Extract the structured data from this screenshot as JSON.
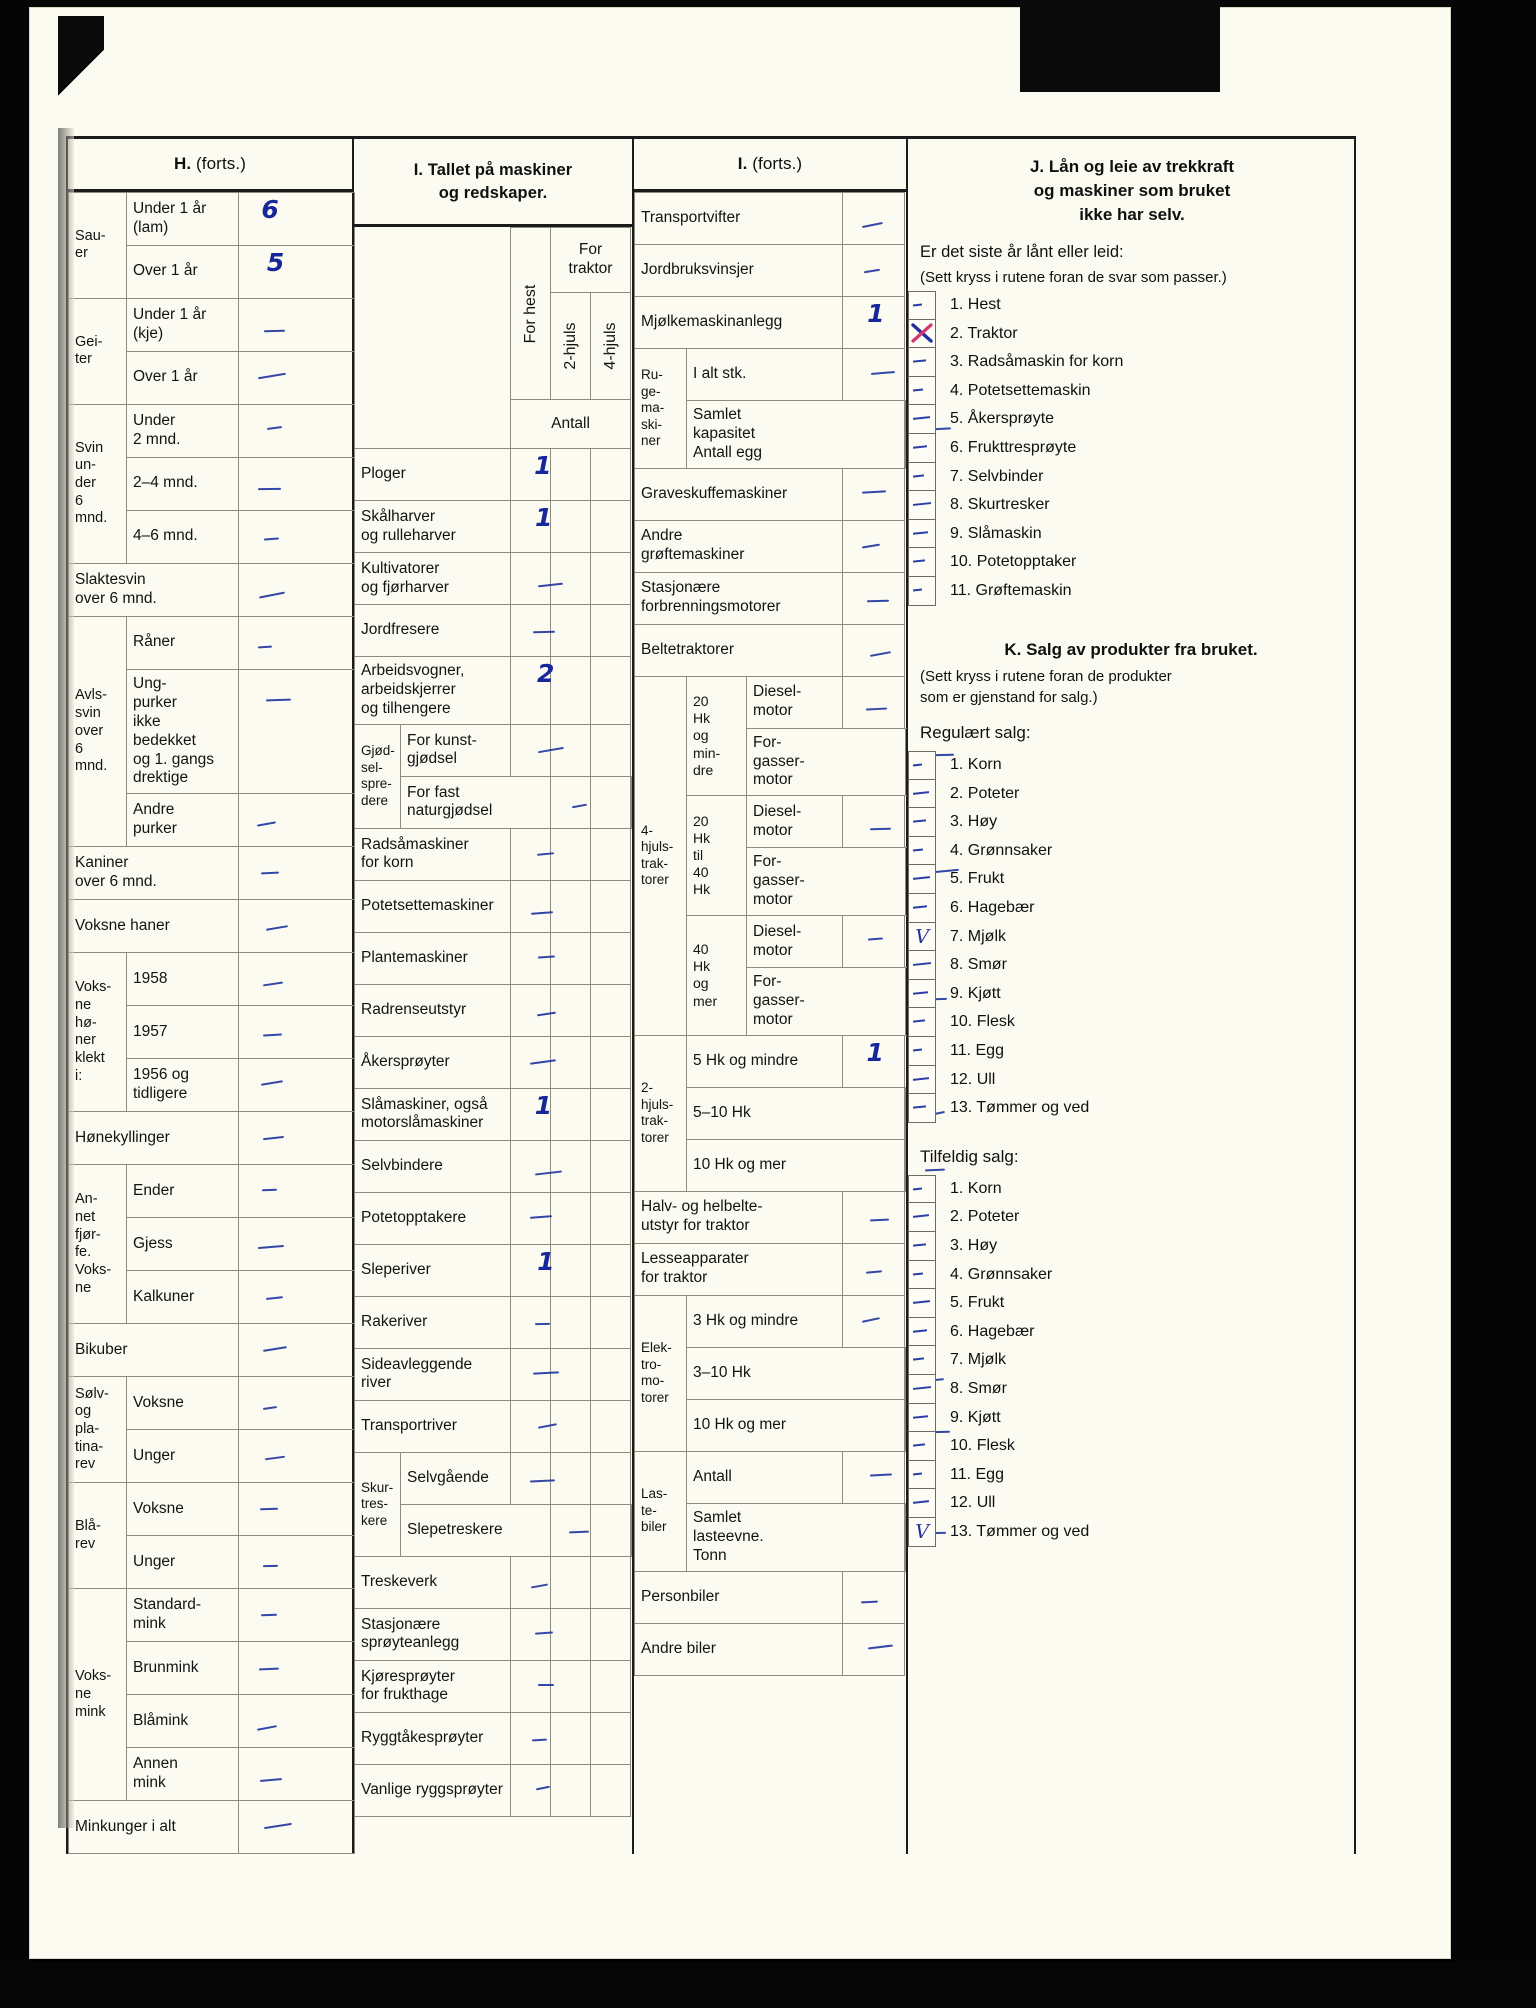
{
  "document": {
    "kind": "norwegian-agricultural-census-form",
    "ink_color": "#1f2f9c",
    "mark_color_x": "#d4356a"
  },
  "columns": {
    "H": {
      "heading_bold": "H.",
      "heading_rest": "(forts.)",
      "rows": [
        {
          "group": "Sau-\ner",
          "group_rows": 2,
          "label": "Under 1 år\n(lam)",
          "value": "6"
        },
        {
          "label": "Over 1 år",
          "value": "5"
        },
        {
          "group": "Gei-\nter",
          "group_rows": 2,
          "label": "Under 1 år\n(kje)",
          "value": "-"
        },
        {
          "label": "Over 1 år",
          "value": "-"
        },
        {
          "group": "Svin\nun-\nder\n6\nmnd.",
          "group_rows": 3,
          "label": "Under\n2 mnd.",
          "value": "-"
        },
        {
          "label": "2–4 mnd.",
          "value": "-"
        },
        {
          "label": "4–6 mnd.",
          "value": "-"
        },
        {
          "label": "Slaktesvin\nover 6 mnd.",
          "full": true,
          "value": "-"
        },
        {
          "group": "Avls-\nsvin\nover\n6\nmnd.",
          "group_rows": 3,
          "label": "Råner",
          "value": "-"
        },
        {
          "label": "Ung-\npurker\nikke\nbedekket\nog 1. gangs\ndrektige",
          "value": "-"
        },
        {
          "label": "Andre\npurker",
          "value": "-"
        },
        {
          "label": "Kaniner\nover 6 mnd.",
          "full": true,
          "value": "-"
        },
        {
          "label": "Voksne haner",
          "full": true,
          "value": "-"
        },
        {
          "group": "Voks-\nne\nhø-\nner\nklekt\ni:",
          "group_rows": 3,
          "label": "1958",
          "value": "-"
        },
        {
          "label": "1957",
          "value": "-"
        },
        {
          "label": "1956 og\ntidligere",
          "value": "-"
        },
        {
          "label": "Hønekyllinger",
          "full": true,
          "value": "-"
        },
        {
          "group": "An-\nnet\nfjør-\nfe.\nVoks-\nne",
          "group_rows": 3,
          "label": "Ender",
          "value": "-"
        },
        {
          "label": "Gjess",
          "value": "-"
        },
        {
          "label": "Kalkuner",
          "value": "-"
        },
        {
          "label": "Bikuber",
          "full": true,
          "value": "-"
        },
        {
          "group": "Sølv-\nog\npla-\ntina-\nrev",
          "group_rows": 2,
          "label": "Voksne",
          "value": "-"
        },
        {
          "label": "Unger",
          "value": "-"
        },
        {
          "group": "Blå-\nrev",
          "group_rows": 2,
          "label": "Voksne",
          "value": "-"
        },
        {
          "label": "Unger",
          "value": "-"
        },
        {
          "group": "Voks-\nne\nmink",
          "group_rows": 4,
          "label": "Standard-\nmink",
          "value": "-"
        },
        {
          "label": "Brunmink",
          "value": "-"
        },
        {
          "label": "Blåmink",
          "value": "-"
        },
        {
          "label": "Annen\nmink",
          "value": "-"
        },
        {
          "label": "Minkunger i alt",
          "full": true,
          "value": "-"
        }
      ]
    },
    "I": {
      "heading_line1": "I. Tallet på maskiner",
      "heading_line2": "og redskaper.",
      "col_headers": {
        "for_traktor": "For\ntraktor",
        "for_hest": "For hest",
        "two_wheel": "2-hjuls",
        "four_wheel": "4-hjuls",
        "antall": "Antall"
      },
      "rows": [
        {
          "label": "Ploger",
          "hest": "1",
          "h2": "",
          "h4": ""
        },
        {
          "label": "Skålharver\nog rulleharver",
          "hest": "1",
          "h2": "",
          "h4": ""
        },
        {
          "label": "Kultivatorer\nog fjørharver",
          "hest": "-",
          "h2": "",
          "h4": ""
        },
        {
          "label": "Jordfresere",
          "hest": "-",
          "h2": "",
          "h4": ""
        },
        {
          "label": "Arbeidsvogner,\narbeidskjerrer\nog tilhengere",
          "hest": "2",
          "h2": "",
          "h4": ""
        },
        {
          "group": "Gjød-\nsel-\nspre-\ndere",
          "group_rows": 2,
          "label": "For kunst-\ngjødsel",
          "hest": "-",
          "h2": "",
          "h4": ""
        },
        {
          "label": "For fast\nnaturgjødsel",
          "hest": "-",
          "h2": "",
          "h4": ""
        },
        {
          "label": "Radsåmaskiner\nfor korn",
          "hest": "-",
          "h2": "",
          "h4": ""
        },
        {
          "label": "Potetsettemaskiner",
          "hest": "-",
          "h2": "",
          "h4": ""
        },
        {
          "label": "Plantemaskiner",
          "hest": "-",
          "h2": "",
          "h4": ""
        },
        {
          "label": "Radrenseutstyr",
          "hest": "-",
          "h2": "",
          "h4": ""
        },
        {
          "label": "Åkersprøyter",
          "hest": "-",
          "h2": "",
          "h4": ""
        },
        {
          "label": "Slåmaskiner, også\nmotorslåmaskiner",
          "hest": "1",
          "h2": "",
          "h4": ""
        },
        {
          "label": "Selvbindere",
          "hest": "-",
          "h2": "",
          "h4": ""
        },
        {
          "label": "Potetopptakere",
          "hest": "-",
          "h2": "",
          "h4": ""
        },
        {
          "label": "Sleperiver",
          "hest": "1",
          "h2": "",
          "h4": ""
        },
        {
          "label": "Rakeriver",
          "hest": "-",
          "h2": "",
          "h4": ""
        },
        {
          "label": "Sideavleggende\nriver",
          "hest": "-",
          "h2": "",
          "h4": ""
        },
        {
          "label": "Transportriver",
          "hest": "-",
          "h2": "",
          "h4": ""
        },
        {
          "group": "Skur-\ntres-\nkere",
          "group_rows": 2,
          "label": "Selvgående",
          "hest": "-",
          "h2": "",
          "h4": ""
        },
        {
          "label": "Slepetreskere",
          "hest": "-",
          "h2": "",
          "h4": ""
        },
        {
          "label": "Treskeverk",
          "hest": "-",
          "h2": "",
          "h4": ""
        },
        {
          "label": "Stasjonære\nsprøyteanlegg",
          "hest": "-",
          "h2": "",
          "h4": ""
        },
        {
          "label": "Kjøresprøyter\nfor frukthage",
          "hest": "-",
          "h2": "",
          "h4": ""
        },
        {
          "label": "Ryggtåkesprøyter",
          "hest": "-",
          "h2": "",
          "h4": ""
        },
        {
          "label": "Vanlige ryggsprøyter",
          "hest": "-",
          "h2": "",
          "h4": ""
        }
      ]
    },
    "I2": {
      "heading_bold": "I.",
      "heading_rest": "(forts.)",
      "rows": [
        {
          "label": "Transportvifter",
          "value": "-"
        },
        {
          "label": "Jordbruksvinsjer",
          "value": "-"
        },
        {
          "label": "Mjølkemaskinanlegg",
          "value": "1"
        },
        {
          "group": "Ru-\nge-\nma-\nski-\nner",
          "group_rows": 2,
          "label": "I alt stk.",
          "value": "-"
        },
        {
          "label": "Samlet\nkapasitet\nAntall egg",
          "value": "-"
        },
        {
          "label": "Graveskuffemaskiner",
          "value": "-"
        },
        {
          "label": "Andre\ngrøftemaskiner",
          "value": "-"
        },
        {
          "label": "Stasjonære\nforbrenningsmotorer",
          "value": "-"
        },
        {
          "label": "Beltetraktorer",
          "value": "-"
        },
        {
          "group": "4-\nhjuls-\ntrak-\ntorer",
          "group_rows": 6,
          "sub": "20\nHk\nog\nmin-\ndre",
          "sub_rows": 2,
          "label": "Diesel-\nmotor",
          "value": "-"
        },
        {
          "label": "For-\ngasser-\nmotor",
          "value": "-"
        },
        {
          "sub": "20\nHk\ntil\n40\nHk",
          "sub_rows": 2,
          "label": "Diesel-\nmotor",
          "value": "-"
        },
        {
          "label": "For-\ngasser-\nmotor",
          "value": "-"
        },
        {
          "sub": "40\nHk\nog\nmer",
          "sub_rows": 2,
          "label": "Diesel-\nmotor",
          "value": "-"
        },
        {
          "label": "For-\ngasser-\nmotor",
          "value": "-"
        },
        {
          "group": "2-\nhjuls-\ntrak-\ntorer",
          "group_rows": 3,
          "label": "5 Hk og mindre",
          "value": "1"
        },
        {
          "label": "5–10 Hk",
          "value": "-"
        },
        {
          "label": "10 Hk og mer",
          "value": "-"
        },
        {
          "label": "Halv- og helbelte-\nutstyr for traktor",
          "value": "-"
        },
        {
          "label": "Lesseapparater\nfor traktor",
          "value": "-"
        },
        {
          "group": "Elek-\ntro-\nmo-\ntorer",
          "group_rows": 3,
          "label": "3 Hk og mindre",
          "value": "-"
        },
        {
          "label": "3–10 Hk",
          "value": "-"
        },
        {
          "label": "10 Hk og mer",
          "value": "-"
        },
        {
          "group": "Las-\nte-\nbiler",
          "group_rows": 2,
          "label": "Antall",
          "value": "-"
        },
        {
          "label": "Samlet\nlasteevne.\nTonn",
          "value": "-"
        },
        {
          "label": "Personbiler",
          "value": "-"
        },
        {
          "label": "Andre biler",
          "value": "-"
        }
      ]
    },
    "J": {
      "heading": "J. Lån og leie av trekkraft\nog maskiner som bruket\nikke har selv.",
      "question": "Er det siste år lånt eller leid:",
      "instruction": "(Sett kryss i rutene foran de svar som passer.)",
      "items": [
        {
          "n": "1.",
          "label": "Hest",
          "mark": "dash"
        },
        {
          "n": "2.",
          "label": "Traktor",
          "mark": "x"
        },
        {
          "n": "3.",
          "label": "Radsåmaskin for korn",
          "mark": "dash"
        },
        {
          "n": "4.",
          "label": "Potetsettemaskin",
          "mark": "dash"
        },
        {
          "n": "5.",
          "label": "Åkersprøyte",
          "mark": "dash"
        },
        {
          "n": "6.",
          "label": "Frukttresprøyte",
          "mark": "dash"
        },
        {
          "n": "7.",
          "label": "Selvbinder",
          "mark": "dash"
        },
        {
          "n": "8.",
          "label": "Skurtresker",
          "mark": "dash"
        },
        {
          "n": "9.",
          "label": "Slåmaskin",
          "mark": "dash"
        },
        {
          "n": "10.",
          "label": "Potetopptaker",
          "mark": "dash"
        },
        {
          "n": "11.",
          "label": "Grøftemaskin",
          "mark": "dash"
        }
      ]
    },
    "K": {
      "heading": "K. Salg av produkter fra bruket.",
      "instruction": "(Sett kryss i rutene foran de produkter\nsom er gjenstand for salg.)",
      "regular_title": "Regulært salg:",
      "regular_items": [
        {
          "n": "1.",
          "label": "Korn",
          "mark": "dash"
        },
        {
          "n": "2.",
          "label": "Poteter",
          "mark": "dash"
        },
        {
          "n": "3.",
          "label": "Høy",
          "mark": "dash"
        },
        {
          "n": "4.",
          "label": "Grønnsaker",
          "mark": "dash"
        },
        {
          "n": "5.",
          "label": "Frukt",
          "mark": "dash"
        },
        {
          "n": "6.",
          "label": "Hagebær",
          "mark": "dash"
        },
        {
          "n": "7.",
          "label": "Mjølk",
          "mark": "tick"
        },
        {
          "n": "8.",
          "label": "Smør",
          "mark": "dash"
        },
        {
          "n": "9.",
          "label": "Kjøtt",
          "mark": "dash"
        },
        {
          "n": "10.",
          "label": "Flesk",
          "mark": "dash"
        },
        {
          "n": "11.",
          "label": "Egg",
          "mark": "dash"
        },
        {
          "n": "12.",
          "label": "Ull",
          "mark": "dash"
        },
        {
          "n": "13.",
          "label": "Tømmer og ved",
          "mark": "dash"
        }
      ],
      "occasional_title": "Tilfeldig salg:",
      "occasional_items": [
        {
          "n": "1.",
          "label": "Korn",
          "mark": "dash"
        },
        {
          "n": "2.",
          "label": "Poteter",
          "mark": "dash"
        },
        {
          "n": "3.",
          "label": "Høy",
          "mark": "dash"
        },
        {
          "n": "4.",
          "label": "Grønnsaker",
          "mark": "dash"
        },
        {
          "n": "5.",
          "label": "Frukt",
          "mark": "dash"
        },
        {
          "n": "6.",
          "label": "Hagebær",
          "mark": "dash"
        },
        {
          "n": "7.",
          "label": "Mjølk",
          "mark": "dash"
        },
        {
          "n": "8.",
          "label": "Smør",
          "mark": "dash"
        },
        {
          "n": "9.",
          "label": "Kjøtt",
          "mark": "dash"
        },
        {
          "n": "10.",
          "label": "Flesk",
          "mark": "dash"
        },
        {
          "n": "11.",
          "label": "Egg",
          "mark": "dash"
        },
        {
          "n": "12.",
          "label": "Ull",
          "mark": "dash"
        },
        {
          "n": "13.",
          "label": "Tømmer og ved",
          "mark": "tick"
        }
      ]
    }
  }
}
